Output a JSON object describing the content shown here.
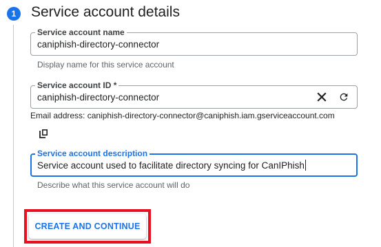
{
  "step": {
    "number": "1",
    "title": "Service account details",
    "accent_color": "#1a73e8"
  },
  "fields": {
    "name": {
      "label": "Service account name",
      "value": "caniphish-directory-connector",
      "hint": "Display name for this service account"
    },
    "id": {
      "label": "Service account ID *",
      "value": "caniphish-directory-connector",
      "clear_icon": "close-icon",
      "refresh_icon": "refresh-icon"
    },
    "email": {
      "text": "Email address: caniphish-directory-connector@caniphish.iam.gserviceaccount.com",
      "copy_icon": "copy-icon"
    },
    "description": {
      "label": "Service account description",
      "value": "Service account used to facilitate directory syncing for CanIPhish",
      "hint": "Describe what this service account will do",
      "focused": true
    }
  },
  "actions": {
    "create_continue_label": "CREATE AND CONTINUE",
    "highlight_color": "#e8101e"
  }
}
